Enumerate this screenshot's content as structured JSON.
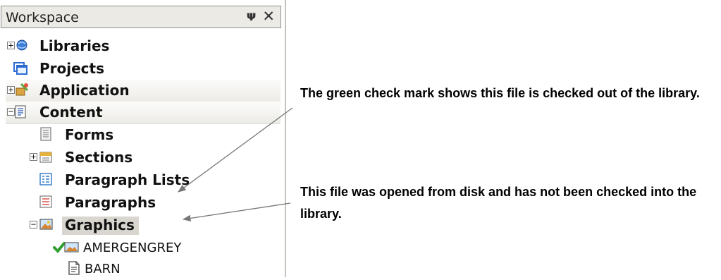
{
  "workspace": {
    "title": "Workspace",
    "pin_glyph": "Ѩ",
    "close_glyph": "✕",
    "items": [
      {
        "label": "Libraries",
        "icon": "libraries-icon"
      },
      {
        "label": "Projects",
        "icon": "projects-icon"
      },
      {
        "label": "Application",
        "icon": "application-icon"
      },
      {
        "label": "Content",
        "icon": "content-icon"
      },
      {
        "label": "Forms",
        "icon": "forms-icon"
      },
      {
        "label": "Sections",
        "icon": "sections-icon"
      },
      {
        "label": "Paragraph Lists",
        "icon": "paragraph-lists-icon"
      },
      {
        "label": "Paragraphs",
        "icon": "paragraphs-icon"
      },
      {
        "label": "Graphics",
        "icon": "graphics-icon"
      },
      {
        "label": "AMERGENGREY",
        "icon": "checked-out-graphic-icon"
      },
      {
        "label": "BARN",
        "icon": "document-icon"
      }
    ]
  },
  "callouts": {
    "checked_out": "The green check mark shows this file is checked out of the library.",
    "opened_from_disk": "This file was opened from disk and has not been checked into the library."
  },
  "colors": {
    "check_green": "#2f9e2f",
    "selected_bg": "#d8d6cf",
    "section_bg": "#ecebe6"
  }
}
